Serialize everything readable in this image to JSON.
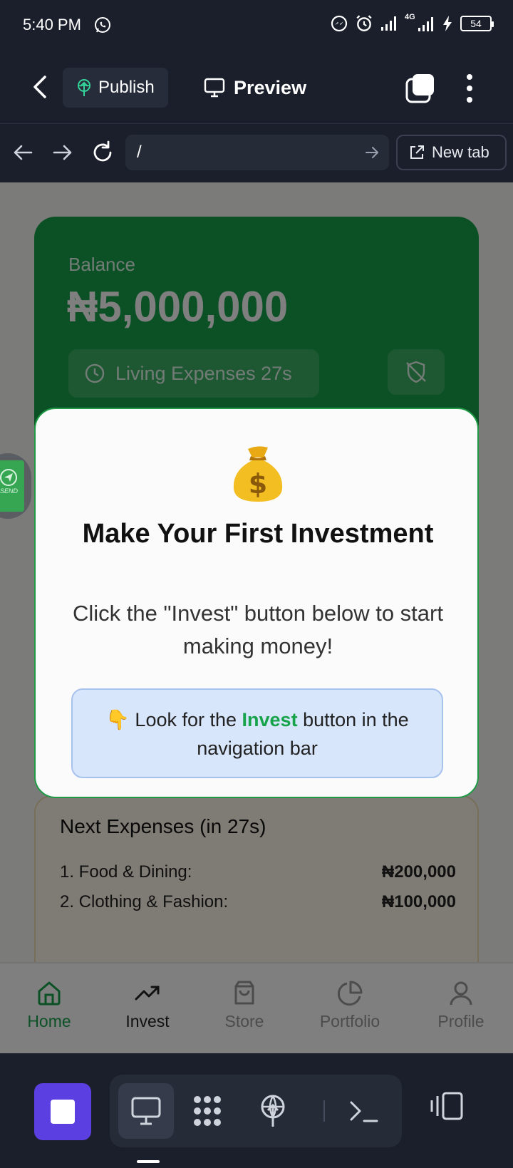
{
  "status_bar": {
    "time": "5:40 PM",
    "battery": "54",
    "network": "4G"
  },
  "toolbar": {
    "publish_label": "Publish",
    "preview_label": "Preview"
  },
  "browser": {
    "url": "/",
    "new_tab_label": "New tab"
  },
  "balance_card": {
    "label": "Balance",
    "amount": "₦5,000,000",
    "timer_label": "Living Expenses 27s"
  },
  "modal": {
    "emoji": "money-bag",
    "title": "Make Your First Investment",
    "text": "Click the \"Invest\" button below to start making money!",
    "hint_prefix": "Look for the ",
    "hint_accent": "Invest",
    "hint_suffix": " button in the navigation bar",
    "hint_emoji": "👇"
  },
  "expenses": {
    "title": "Next Expenses (in 27s)",
    "items": [
      {
        "label": "1. Food & Dining:",
        "amount": "₦200,000"
      },
      {
        "label": "2. Clothing & Fashion:",
        "amount": "₦100,000"
      }
    ]
  },
  "send_fab": {
    "label": "SEND"
  },
  "bottom_nav": {
    "items": [
      {
        "label": "Home",
        "icon": "home-icon",
        "active": true
      },
      {
        "label": "Invest",
        "icon": "trending-up-icon"
      },
      {
        "label": "Store",
        "icon": "shopping-bag-icon"
      },
      {
        "label": "Portfolio",
        "icon": "pie-chart-icon"
      },
      {
        "label": "Profile",
        "icon": "user-icon"
      }
    ]
  },
  "colors": {
    "accent_green": "#16a34a",
    "app_dark": "#1b1f2c",
    "stop_purple": "#5b3fe0"
  }
}
